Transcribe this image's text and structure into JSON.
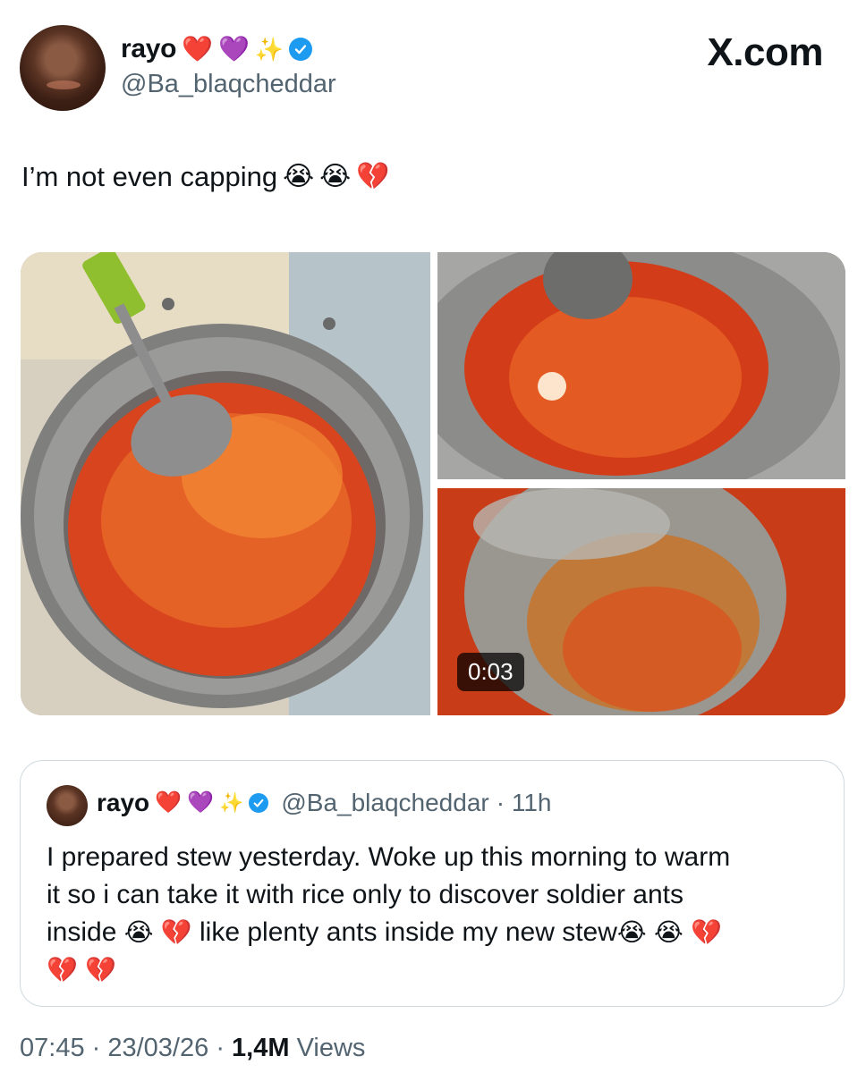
{
  "header": {
    "display_name": "rayo",
    "name_emojis": [
      "❤️",
      "💜",
      "✨"
    ],
    "handle": "@Ba_blaqcheddar",
    "brand": "X.com",
    "avatar_icon": "profile-avatar"
  },
  "tweet": {
    "text": "I’m not even capping",
    "emojis": [
      "😭",
      "😭",
      "💔"
    ]
  },
  "media": {
    "video_duration": "0:03",
    "images": [
      "pot-of-stew",
      "stew-close-up",
      "spoon-video-thumbnail"
    ]
  },
  "quoted": {
    "display_name": "rayo",
    "name_emojis": [
      "❤️",
      "💜",
      "✨"
    ],
    "handle": "@Ba_blaqcheddar",
    "time": "· 11h",
    "line1": "I prepared stew yesterday. Woke up this morning to warm",
    "line2": "it so i can take it with rice only to discover soldier ants",
    "line3a": "inside",
    "line3b": "like plenty ants inside my new stew",
    "emojis_a": [
      "😭",
      "💔"
    ],
    "emojis_b": [
      "😭",
      "😭",
      "💔"
    ],
    "emojis_c": [
      "💔",
      "💔"
    ]
  },
  "footer": {
    "time": "07:45",
    "date": "23/03/26",
    "views_count": "1,4M",
    "views_label": "Views"
  },
  "colors": {
    "verified": "#1d9bf0",
    "secondary_text": "#536471",
    "border": "#cfd9de"
  }
}
